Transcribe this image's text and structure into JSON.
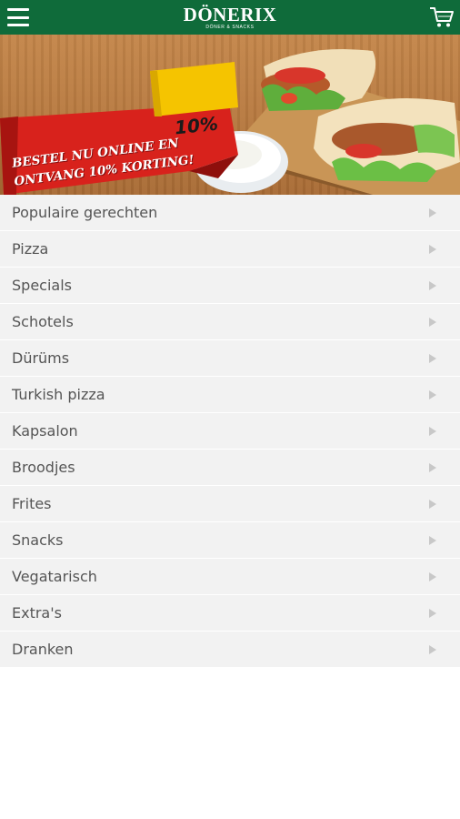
{
  "header": {
    "logo_name": "DÖNERIX",
    "logo_tagline": "DÖNER & SNACKS",
    "menu_icon": "hamburger-menu-icon",
    "cart_icon": "shopping-cart-icon"
  },
  "banner": {
    "badge": "10%",
    "promo_line1": "BESTEL NU ONLINE EN",
    "promo_line2": "ONTVANG 10% KORTING!"
  },
  "categories": [
    {
      "label": "Populaire gerechten"
    },
    {
      "label": "Pizza"
    },
    {
      "label": "Specials"
    },
    {
      "label": "Schotels"
    },
    {
      "label": "Dürüms"
    },
    {
      "label": "Turkish pizza"
    },
    {
      "label": "Kapsalon"
    },
    {
      "label": "Broodjes"
    },
    {
      "label": "Frites"
    },
    {
      "label": "Snacks"
    },
    {
      "label": "Vegatarisch"
    },
    {
      "label": "Extra's"
    },
    {
      "label": "Dranken"
    }
  ],
  "colors": {
    "header_bg": "#0f6b3a",
    "list_bg": "#f2f2f2",
    "promo_red": "#d8221c",
    "badge_yellow": "#f5c400"
  }
}
